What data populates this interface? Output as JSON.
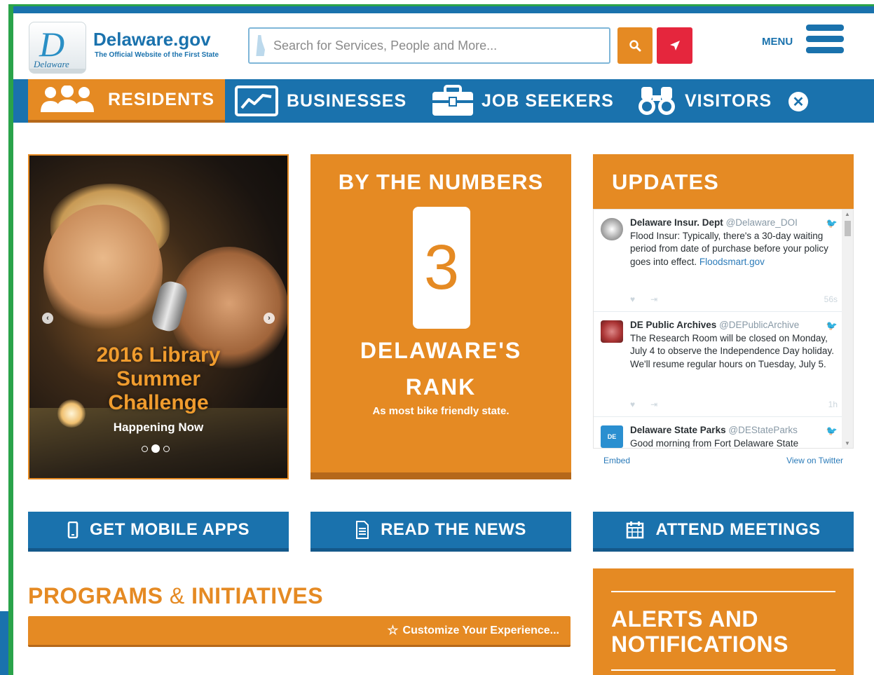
{
  "header": {
    "logo_text": "Delaware",
    "site_title": "Delaware.gov",
    "site_subtitle": "The Official Website of the First State",
    "search_placeholder": "Search for Services, People and More...",
    "menu_label": "MENU"
  },
  "nav": {
    "items": [
      {
        "label": "RESIDENTS",
        "icon": "people-icon",
        "active": true
      },
      {
        "label": "BUSINESSES",
        "icon": "chart-icon",
        "active": false
      },
      {
        "label": "JOB SEEKERS",
        "icon": "briefcase-icon",
        "active": false
      },
      {
        "label": "VISITORS",
        "icon": "binoculars-icon",
        "active": false
      }
    ],
    "close_icon": "close-icon"
  },
  "slider": {
    "title_line1": "2016 Library",
    "title_line2": "Summer",
    "title_line3": "Challenge",
    "subtitle": "Happening Now",
    "dot_count": 3,
    "active_dot": 2
  },
  "numbers": {
    "heading": "BY THE NUMBERS",
    "value": "3",
    "rank_line1": "DELAWARE'S",
    "rank_line2": "RANK",
    "note": "As most bike friendly state."
  },
  "updates": {
    "heading": "UPDATES",
    "tweets": [
      {
        "name": "Delaware Insur. Dept",
        "handle": "@Delaware_DOI",
        "text": "Flood Insur: Typically, there's a 30-day waiting period from date of purchase before your policy goes into effect. ",
        "link": "Floodsmart.gov",
        "time": "56s"
      },
      {
        "name": "DE Public Archives",
        "handle": "@DEPublicArchive",
        "text": "The Research Room will be closed on Monday, July 4 to observe the Independence Day holiday. We'll resume regular hours on Tuesday, July 5.",
        "link": "",
        "time": "1h"
      },
      {
        "name": "Delaware State Parks",
        "handle": "@DEStateParks",
        "text": "Good morning from Fort Delaware State",
        "link": "",
        "time": ""
      }
    ],
    "embed_label": "Embed",
    "view_label": "View on Twitter"
  },
  "actions": [
    {
      "label": "GET MOBILE APPS",
      "icon": "mobile-icon"
    },
    {
      "label": "READ THE NEWS",
      "icon": "document-icon"
    },
    {
      "label": "ATTEND MEETINGS",
      "icon": "calendar-icon"
    }
  ],
  "programs": {
    "title_part1": "PROGRAMS",
    "title_amp": "&",
    "title_part2": "INITIATIVES",
    "customize_label": "Customize Your Experience..."
  },
  "alerts": {
    "line1": "ALERTS AND",
    "line2": "NOTIFICATIONS"
  },
  "colors": {
    "brand_blue": "#1a72ad",
    "brand_orange": "#e58a23",
    "alert_red": "#e5263d",
    "frame_green": "#2aa34a"
  }
}
